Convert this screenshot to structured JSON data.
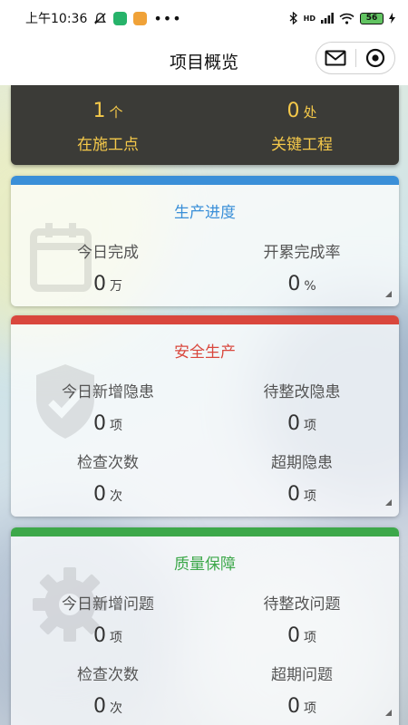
{
  "status_bar": {
    "time": "上午10:36",
    "battery": "56",
    "network": "HD"
  },
  "header": {
    "title": "项目概览"
  },
  "summary": {
    "items": [
      {
        "value": "1",
        "unit": "个",
        "label": "在施工点"
      },
      {
        "value": "0",
        "unit": "处",
        "label": "关键工程"
      }
    ]
  },
  "production": {
    "title": "生产进度",
    "accent": "#3a8fd8",
    "items": [
      {
        "label": "今日完成",
        "value": "0",
        "unit": "万"
      },
      {
        "label": "开累完成率",
        "value": "0",
        "unit": "%"
      }
    ]
  },
  "safety": {
    "title": "安全生产",
    "accent": "#d9473d",
    "items": [
      {
        "label": "今日新增隐患",
        "value": "0",
        "unit": "项"
      },
      {
        "label": "待整改隐患",
        "value": "0",
        "unit": "项"
      },
      {
        "label": "检查次数",
        "value": "0",
        "unit": "次"
      },
      {
        "label": "超期隐患",
        "value": "0",
        "unit": "项"
      }
    ]
  },
  "quality": {
    "title": "质量保障",
    "accent": "#3da84a",
    "items": [
      {
        "label": "今日新增问题",
        "value": "0",
        "unit": "项"
      },
      {
        "label": "待整改问题",
        "value": "0",
        "unit": "项"
      },
      {
        "label": "检查次数",
        "value": "0",
        "unit": "次"
      },
      {
        "label": "超期问题",
        "value": "0",
        "unit": "项"
      }
    ]
  },
  "icons": [
    "mute-icon",
    "app-shield-icon",
    "app-note-icon",
    "more-dots-icon",
    "bluetooth-icon",
    "signal-icon",
    "wifi-icon",
    "battery-icon",
    "charging-icon",
    "mail-icon",
    "target-icon",
    "calendar-watermark-icon",
    "shield-check-watermark-icon",
    "gear-watermark-icon",
    "corner-triangle-icon"
  ]
}
